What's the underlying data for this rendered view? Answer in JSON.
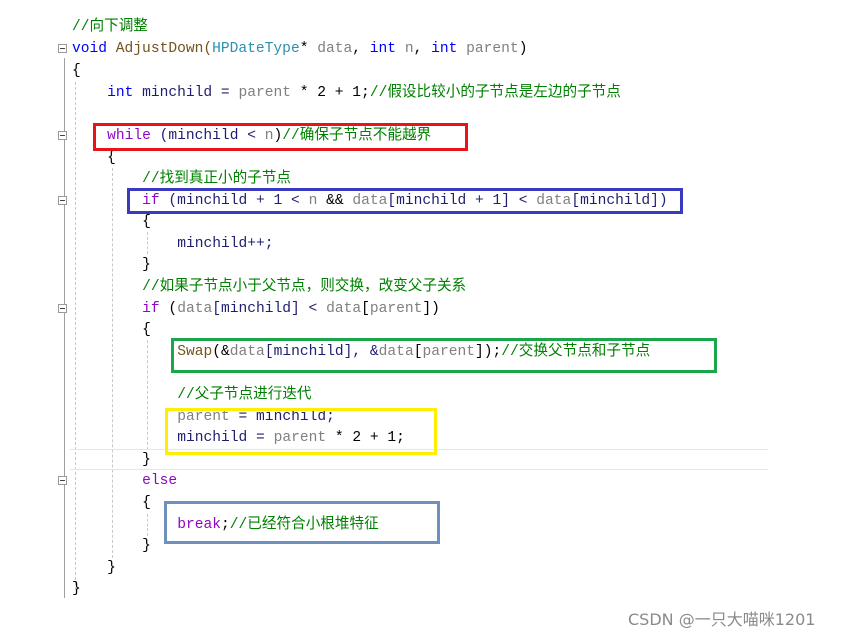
{
  "editor": {
    "lines": [
      {
        "indent": 0,
        "tokens": [
          [
            "//向下调整",
            "cm"
          ]
        ]
      },
      {
        "indent": 0,
        "fold": true,
        "tokens": [
          [
            "void",
            "kw"
          ],
          [
            " AdjustDown(",
            "fn"
          ],
          [
            "HPDateType",
            "ty"
          ],
          [
            "* ",
            "pl"
          ],
          [
            "data",
            "pm"
          ],
          [
            ", ",
            "pl"
          ],
          [
            "int",
            "kw"
          ],
          [
            " ",
            "pl"
          ],
          [
            "n",
            "pm"
          ],
          [
            ", ",
            "pl"
          ],
          [
            "int",
            "kw"
          ],
          [
            " ",
            "pl"
          ],
          [
            "parent",
            "pm"
          ],
          [
            ")",
            "pl"
          ]
        ]
      },
      {
        "indent": 0,
        "tokens": [
          [
            "{",
            "pl"
          ]
        ]
      },
      {
        "indent": 4,
        "tokens": [
          [
            "int",
            "kw"
          ],
          [
            " minchild = ",
            "loc"
          ],
          [
            "parent",
            "pm"
          ],
          [
            " * 2 + 1;",
            "pl"
          ],
          [
            "//假设比较小的子节点是左边的子节点",
            "cm"
          ]
        ]
      },
      {
        "indent": 4,
        "fold": true,
        "tokens": [
          [
            "while",
            "ctl"
          ],
          [
            " (minchild < ",
            "loc"
          ],
          [
            "n",
            "pm"
          ],
          [
            ")",
            "pl"
          ],
          [
            "//确保子节点不能越界",
            "cm"
          ]
        ]
      },
      {
        "indent": 4,
        "tokens": [
          [
            "{",
            "pl"
          ]
        ]
      },
      {
        "indent": 8,
        "tokens": [
          [
            "//找到真正小的子节点",
            "cm"
          ]
        ]
      },
      {
        "indent": 8,
        "fold": true,
        "tokens": [
          [
            "if",
            "ctl"
          ],
          [
            " (minchild + 1 < ",
            "loc"
          ],
          [
            "n",
            "pm"
          ],
          [
            " && ",
            "pl"
          ],
          [
            "data",
            "pm"
          ],
          [
            "[minchild + 1] < ",
            "loc"
          ],
          [
            "data",
            "pm"
          ],
          [
            "[minchild])",
            "loc"
          ]
        ]
      },
      {
        "indent": 8,
        "tokens": [
          [
            "{",
            "pl"
          ]
        ]
      },
      {
        "indent": 12,
        "tokens": [
          [
            "minchild++;",
            "loc"
          ]
        ]
      },
      {
        "indent": 8,
        "tokens": [
          [
            "}",
            "pl"
          ]
        ]
      },
      {
        "indent": 8,
        "tokens": [
          [
            "//如果子节点小于父节点，则交换，改变父子关系",
            "cm"
          ]
        ]
      },
      {
        "indent": 8,
        "fold": true,
        "tokens": [
          [
            "if",
            "ctl"
          ],
          [
            " (",
            "pl"
          ],
          [
            "data",
            "pm"
          ],
          [
            "[minchild] < ",
            "loc"
          ],
          [
            "data",
            "pm"
          ],
          [
            "[",
            "pl"
          ],
          [
            "parent",
            "pm"
          ],
          [
            "])",
            "pl"
          ]
        ]
      },
      {
        "indent": 8,
        "tokens": [
          [
            "{",
            "pl"
          ]
        ]
      },
      {
        "indent": 12,
        "tokens": [
          [
            "Swap",
            "fn"
          ],
          [
            "(&",
            "pl"
          ],
          [
            "data",
            "pm"
          ],
          [
            "[minchild], &",
            "loc"
          ],
          [
            "data",
            "pm"
          ],
          [
            "[",
            "pl"
          ],
          [
            "parent",
            "pm"
          ],
          [
            "]);",
            "pl"
          ],
          [
            "//交换父节点和子节点",
            "cm"
          ]
        ]
      },
      {
        "indent": 12,
        "tokens": [
          [
            "//父子节点进行迭代",
            "cm"
          ]
        ]
      },
      {
        "indent": 12,
        "tokens": [
          [
            "parent",
            "pm"
          ],
          [
            " = minchild;",
            "loc"
          ]
        ]
      },
      {
        "indent": 12,
        "tokens": [
          [
            "minchild = ",
            "loc"
          ],
          [
            "parent",
            "pm"
          ],
          [
            " * 2 + 1;",
            "pl"
          ]
        ]
      },
      {
        "indent": 8,
        "tokens": [
          [
            "}",
            "pl"
          ]
        ]
      },
      {
        "indent": 8,
        "fold": true,
        "tokens": [
          [
            "else",
            "ctl"
          ]
        ]
      },
      {
        "indent": 8,
        "tokens": [
          [
            "{",
            "pl"
          ]
        ]
      },
      {
        "indent": 12,
        "tokens": [
          [
            "break",
            "ctl"
          ],
          [
            ";",
            "pl"
          ],
          [
            "//已经符合小根堆特征",
            "cm"
          ]
        ]
      },
      {
        "indent": 8,
        "tokens": [
          [
            "}",
            "pl"
          ]
        ]
      },
      {
        "indent": 4,
        "tokens": [
          [
            "}",
            "pl"
          ]
        ]
      },
      {
        "indent": 0,
        "tokens": [
          [
            "}",
            "pl"
          ]
        ]
      }
    ]
  },
  "highlight_colors": {
    "red": "#e8141c",
    "blue": "#3a3ac0",
    "green": "#1aa64a",
    "yellow": "#ffee00",
    "slate": "#6f8fbf"
  },
  "watermark": "CSDN @一只大喵咪1201"
}
